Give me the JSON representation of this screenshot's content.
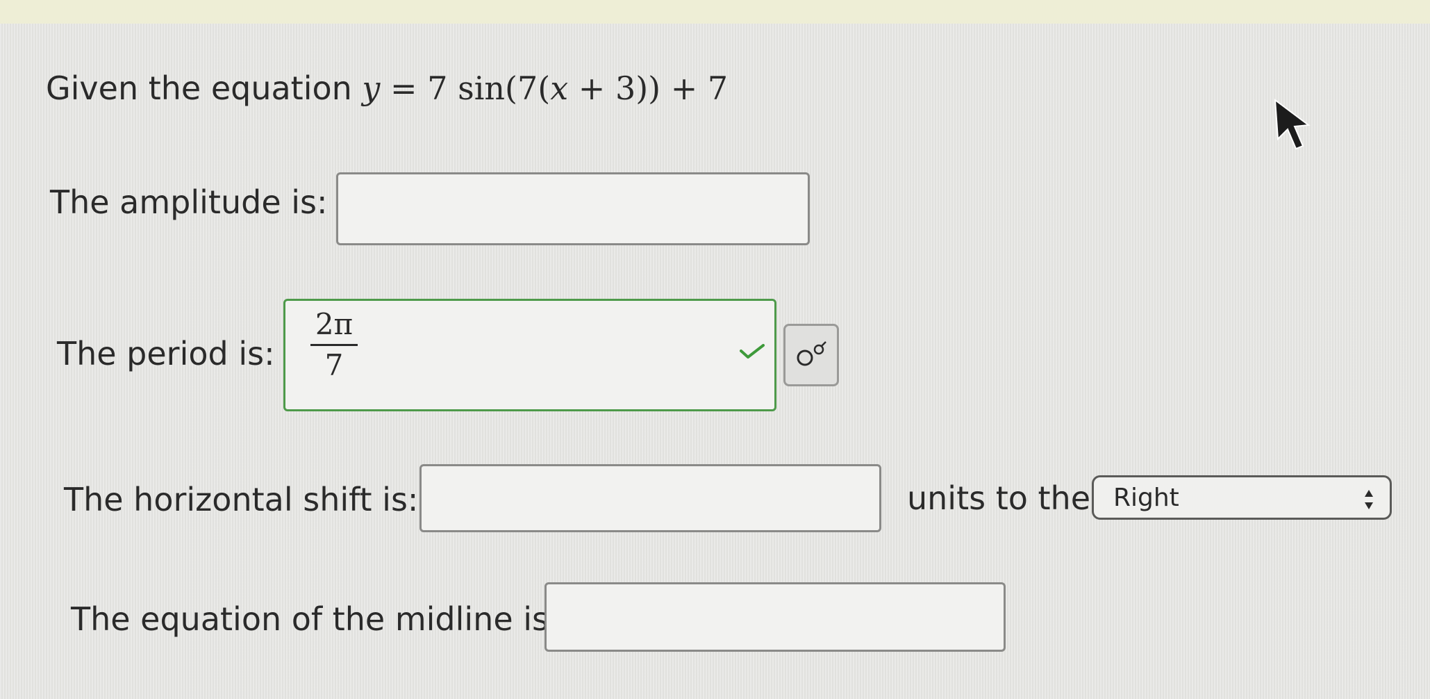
{
  "question": {
    "intro_label": "Given the equation",
    "equation": {
      "y": "y",
      "equals": " = 7 sin(7(",
      "x": "x",
      "rest": " + 3)) + 7"
    }
  },
  "amplitude": {
    "label": "The amplitude is:",
    "value": ""
  },
  "period": {
    "label": "The period is:",
    "numerator": "2π",
    "denominator": "7",
    "status": "correct"
  },
  "horizontal_shift": {
    "label": "The horizontal shift is:",
    "value": "",
    "units_label": "units to the",
    "direction_selected": "Right"
  },
  "midline": {
    "label": "The equation of the midline is:",
    "value": ""
  },
  "icons": {
    "check": "check-icon",
    "symbol_button": "gender-symbol-icon",
    "select_arrows": "updown-arrows-icon",
    "cursor": "mouse-cursor-icon"
  },
  "colors": {
    "correct_border": "#4e9a4a",
    "check_mark": "#3e9a3a",
    "text": "#2a2a2a"
  }
}
